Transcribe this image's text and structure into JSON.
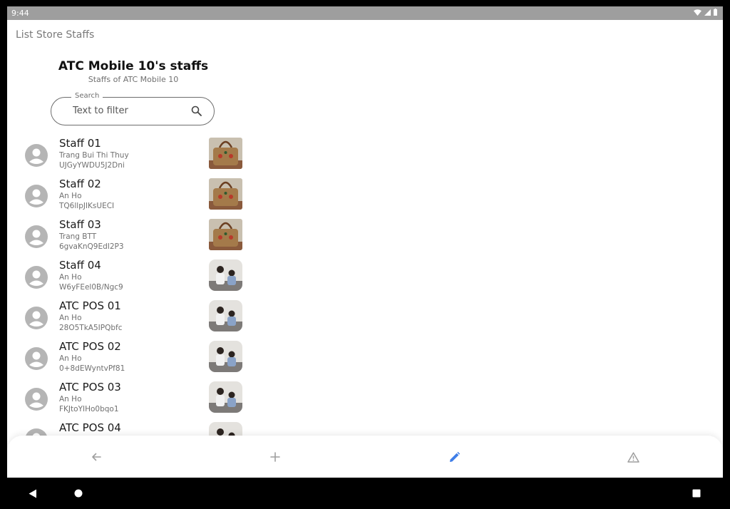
{
  "status_bar": {
    "time": "9:44"
  },
  "app_title": "List Store Staffs",
  "store": {
    "title": "ATC Mobile 10's staffs",
    "subtitle": "Staffs of ATC Mobile 10"
  },
  "search": {
    "label": "Search",
    "placeholder": "Text to filter",
    "value": ""
  },
  "staffs": [
    {
      "name": "Staff 01",
      "full_name": "Trang Bui Thi Thuy",
      "code": "UJGyYWDU5J2Dni",
      "thumb": "handbag"
    },
    {
      "name": "Staff 02",
      "full_name": "An Ho",
      "code": "TQ6llpJIKsUECI",
      "thumb": "handbag"
    },
    {
      "name": "Staff 03",
      "full_name": "Trang BTT",
      "code": "6gvaKnQ9EdI2P3",
      "thumb": "handbag"
    },
    {
      "name": "Staff 04",
      "full_name": "An Ho",
      "code": "W6yFEel0B/Ngc9",
      "thumb": "people-photo"
    },
    {
      "name": "ATC POS 01",
      "full_name": "An Ho",
      "code": "28O5TkA5IPQbfc",
      "thumb": "people-photo"
    },
    {
      "name": "ATC POS 02",
      "full_name": "An Ho",
      "code": "0+8dEWyntvPf81",
      "thumb": "people-photo"
    },
    {
      "name": "ATC POS 03",
      "full_name": "An Ho",
      "code": "FKJtoYIHo0bqo1",
      "thumb": "people-photo"
    },
    {
      "name": "ATC POS 04",
      "full_name": "",
      "code": "",
      "thumb": "people-photo"
    }
  ],
  "bottom_nav": {
    "items": [
      {
        "icon": "back-arrow-icon",
        "active": false
      },
      {
        "icon": "plus-icon",
        "active": false
      },
      {
        "icon": "pencil-icon",
        "active": true
      },
      {
        "icon": "warning-icon",
        "active": false
      }
    ]
  },
  "colors": {
    "accent": "#3f7ee8",
    "inactive_icon": "#9e9e9e",
    "status_bar": "#9e9e9e",
    "avatar": "#b5b5b5"
  }
}
